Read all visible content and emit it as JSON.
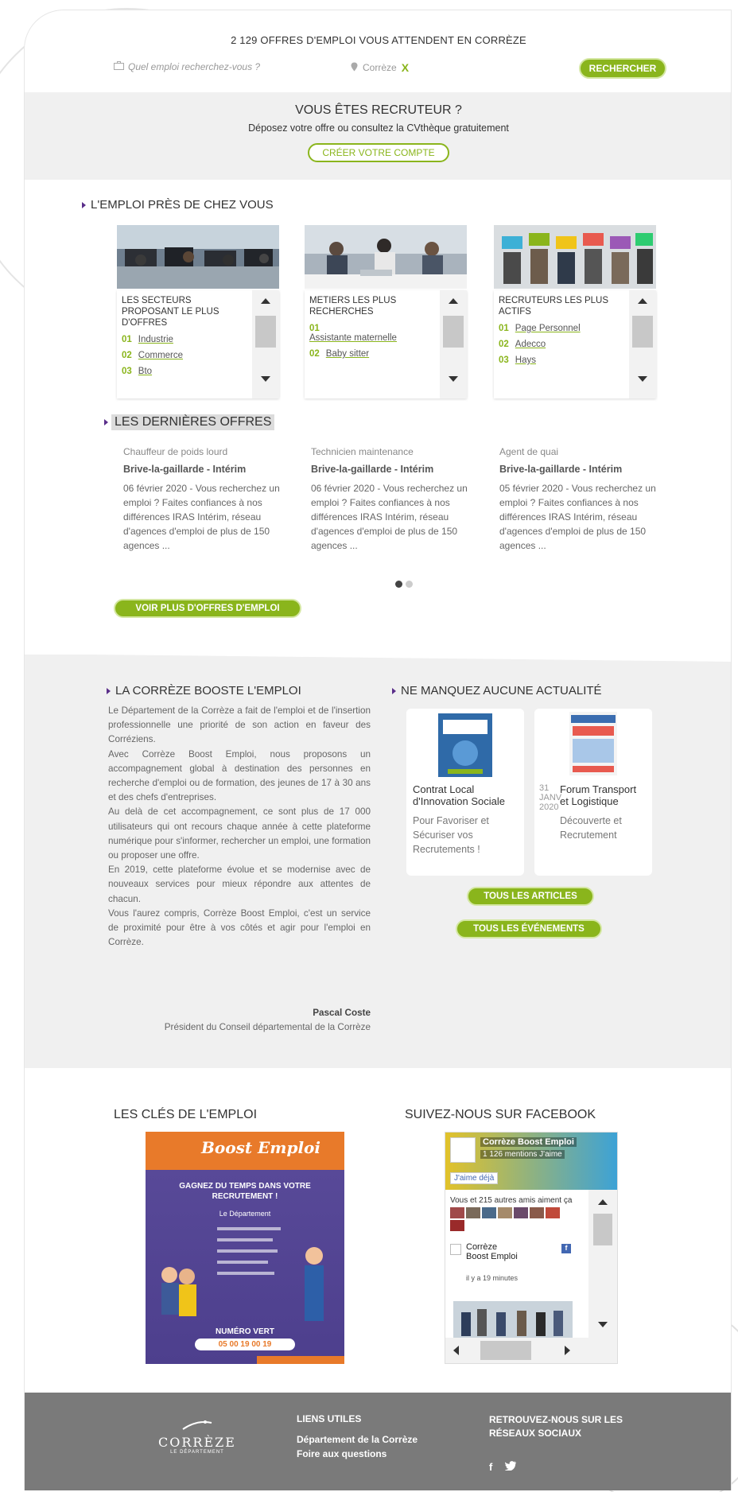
{
  "header": {
    "title": "2 129 OFFRES D'EMPLOI VOUS ATTENDENT EN CORRÈZE",
    "search_placeholder": "Quel emploi recherchez-vous ?",
    "location_value": "Corrèze",
    "clear_label": "X",
    "search_button": "RECHERCHER"
  },
  "recruiter": {
    "title": "VOUS ÊTES RECRUTEUR ?",
    "text": "Déposez votre offre ou consultez la CVthèque gratuitement",
    "button": "CRÉER VOTRE COMPTE"
  },
  "emploi_proche": {
    "title": "L'EMPLOI PRÈS DE CHEZ VOUS",
    "cards": [
      {
        "title": "LES SECTEURS PROPOSANT LE PLUS D'OFFRES",
        "items": [
          {
            "num": "01",
            "label": "Industrie"
          },
          {
            "num": "02",
            "label": "Commerce"
          },
          {
            "num": "03",
            "label": "Bto"
          }
        ]
      },
      {
        "title": "METIERS LES PLUS RECHERCHES",
        "items": [
          {
            "num": "01",
            "label": "Assistante maternelle"
          },
          {
            "num": "02",
            "label": "Baby sitter"
          }
        ]
      },
      {
        "title": "RECRUTEURS LES PLUS ACTIFS",
        "items": [
          {
            "num": "01",
            "label": "Page Personnel"
          },
          {
            "num": "02",
            "label": "Adecco"
          },
          {
            "num": "03",
            "label": "Hays"
          }
        ]
      }
    ]
  },
  "offers": {
    "title": "LES DERNIÈRES OFFRES",
    "items": [
      {
        "job": "Chauffeur de poids lourd",
        "place": "Brive-la-gaillarde - Intérim",
        "desc": "06 février 2020 - Vous recherchez un emploi ? Faites confiances à nos différences IRAS Intérim, réseau d'agences d'emploi de plus de 150 agences ..."
      },
      {
        "job": "Technicien maintenance",
        "place": "Brive-la-gaillarde - Intérim",
        "desc": "06 février 2020 - Vous recherchez un emploi ? Faites confiances à nos différences IRAS Intérim, réseau d'agences d'emploi de plus de 150 agences ..."
      },
      {
        "job": "Agent de quai",
        "place": "Brive-la-gaillarde - Intérim",
        "desc": "05 février 2020 - Vous recherchez un emploi ? Faites confiances à nos différences IRAS Intérim, réseau d'agences d'emploi de plus de 150 agences ..."
      }
    ],
    "more_button": "VOIR PLUS D'OFFRES D'EMPLOI"
  },
  "boost": {
    "title": "LA CORRÈZE BOOSTE L'EMPLOI",
    "paragraphs": [
      "Le Département de la Corrèze a fait de l'emploi et de l'insertion professionnelle une priorité de son action en faveur des Corréziens.",
      "Avec Corrèze Boost Emploi, nous proposons un accompagnement global à destination des personnes en recherche d'emploi ou de formation, des jeunes de 17 à 30 ans et des chefs d'entreprises.",
      "Au delà de cet accompagnement, ce sont plus de 17 000 utilisateurs qui ont recours chaque année à cette plateforme numérique pour s'informer, rechercher un emploi, une formation ou proposer une offre.",
      "En 2019, cette plateforme évolue et se modernise avec de nouveaux services pour mieux répondre aux attentes de chacun.",
      "Vous l'aurez compris, Corrèze Boost Emploi, c'est un service de proximité pour être à vos côtés et agir pour l'emploi en Corrèze."
    ],
    "signature_name": "Pascal Coste",
    "signature_role": "Président du Conseil départemental de la Corrèze"
  },
  "news": {
    "title": "NE MANQUEZ AUCUNE ACTUALITÉ",
    "cards": [
      {
        "title": "Contrat Local d'Innovation Sociale",
        "text": "Pour Favoriser et Sécuriser vos Recrutements !"
      },
      {
        "date_day": "31",
        "date_month": "JANV",
        "date_year": "2020",
        "title": "Forum Transport et Logistique",
        "text": "Découverte et Recrutement"
      }
    ],
    "all_articles": "TOUS LES ARTICLES",
    "all_events": "TOUS LES ÉVÉNEMENTS"
  },
  "keys": {
    "title": "LES CLÉS DE L'EMPLOI",
    "poster": {
      "brand": "Boost Emploi",
      "headline": "GAGNEZ DU TEMPS DANS VOTRE RECRUTEMENT !",
      "sub": "Le Département",
      "phone_label": "NUMÉRO VERT",
      "phone": "05 00 19 00 19"
    }
  },
  "facebook": {
    "title": "SUIVEZ-NOUS SUR FACEBOOK",
    "page_name": "Corrèze Boost Emploi",
    "likes": "1 126 mentions J'aime",
    "like_button": "J'aime déjà",
    "friends": "Vous et 215 autres amis aiment ça",
    "post_author": "Corrèze Boost Emploi",
    "post_time": "il y a 19 minutes"
  },
  "footer": {
    "logo_text": "CORRÈZE",
    "logo_sub": "LE DÉPARTEMENT",
    "links_title": "LIENS UTILES",
    "links": [
      "Département de la Corrèze",
      "Foire aux questions"
    ],
    "social_title": "RETROUVEZ-NOUS SUR LES RÉSEAUX SOCIAUX",
    "facebook_icon": "f",
    "twitter_icon": "t"
  },
  "colors": {
    "accent": "#8ab51c",
    "band": "#f0f0f0",
    "footer": "#7a7a7a",
    "bullet": "#5a2e8a"
  }
}
